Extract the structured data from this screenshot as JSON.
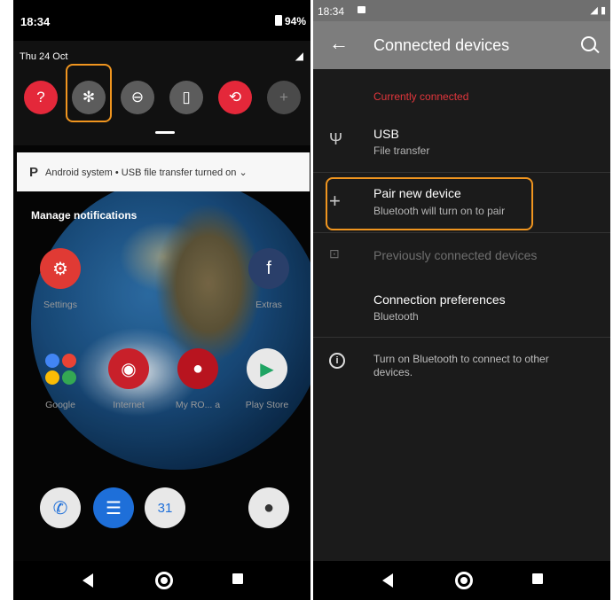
{
  "left": {
    "status_time": "18:34",
    "battery_text": "94%",
    "date": "Thu 24 Oct",
    "quick_tiles": [
      {
        "icon": "wifi-question-icon",
        "glyph": "?"
      },
      {
        "icon": "bluetooth-icon",
        "glyph": "✻"
      },
      {
        "icon": "do-not-disturb-icon",
        "glyph": "⊖"
      },
      {
        "icon": "flashlight-icon",
        "glyph": "▯"
      },
      {
        "icon": "auto-rotate-icon",
        "glyph": "⟲"
      },
      {
        "icon": "battery-saver-icon",
        "glyph": "+"
      }
    ],
    "notification": {
      "app_glyph": "P",
      "text": "Android system • USB file transfer turned on ⌄"
    },
    "manage_label": "Manage notifications",
    "apps": [
      {
        "label": "Settings"
      },
      {
        "label": "Extras"
      },
      {
        "label": "Google"
      },
      {
        "label": "Internet"
      },
      {
        "label": "My RO... a"
      },
      {
        "label": "Play Store"
      }
    ],
    "dock_calendar": "31",
    "colors": {
      "accent_red": "#e4283a",
      "highlight_orange": "#f0951f"
    }
  },
  "right": {
    "status_time": "18:34",
    "title": "Connected devices",
    "section_currently": "Currently connected",
    "usb": {
      "title": "USB",
      "subtitle": "File transfer",
      "icon": "usb-icon"
    },
    "pair": {
      "title": "Pair new device",
      "subtitle": "Bluetooth will turn on to pair",
      "icon": "plus-icon"
    },
    "previously": {
      "title": "Previously connected devices",
      "icon": "devices-icon"
    },
    "prefs": {
      "title": "Connection preferences",
      "subtitle": "Bluetooth"
    },
    "info_text": "Turn on Bluetooth to connect to other devices.",
    "colors": {
      "section_red": "#e2363c",
      "appbar_gray": "#7d7d7d"
    }
  }
}
